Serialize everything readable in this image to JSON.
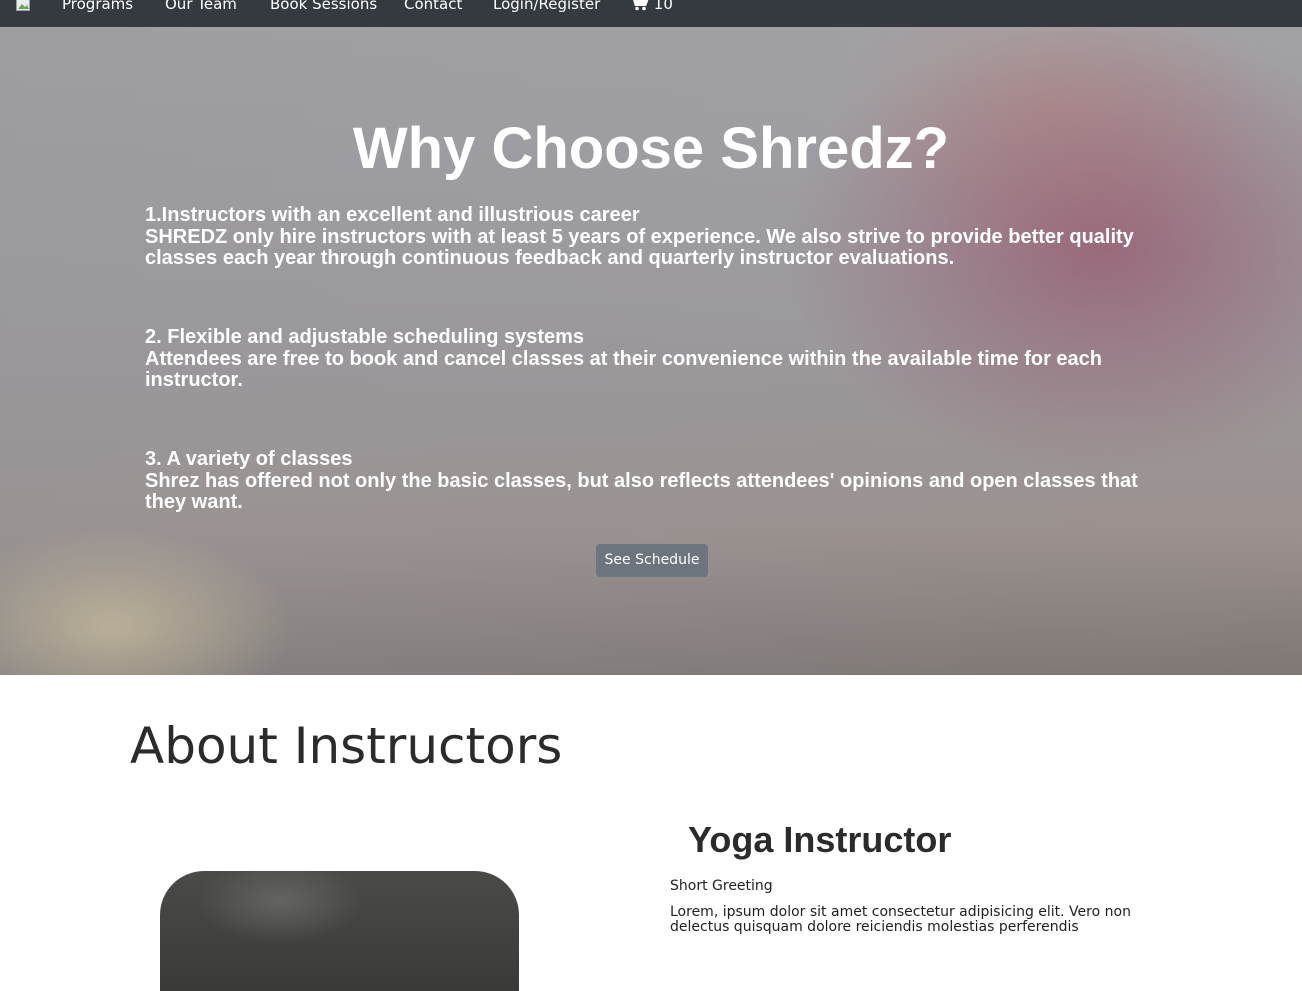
{
  "navbar": {
    "items": [
      {
        "label": "Programs"
      },
      {
        "label": "Our Team"
      },
      {
        "label": "Book Sessions"
      },
      {
        "label": "Contact"
      },
      {
        "label": "Login/Register"
      }
    ],
    "cart_count": "10"
  },
  "hero": {
    "title": "Why Choose Shredz?",
    "features": [
      {
        "heading": "1.Instructors with an excellent and illustrious career",
        "text": "SHREDZ only hire instructors with at least 5 years of experience. We also strive to provide better quality classes each year through continuous feedback and quarterly instructor evaluations."
      },
      {
        "heading": "2. Flexible and adjustable scheduling systems",
        "text": "Attendees are free to book and cancel classes at their convenience within the available time for each instructor."
      },
      {
        "heading": "3. A variety of classes",
        "text": "Shrez has offered not only the basic classes, but also reflects attendees' opinions and open classes that they want."
      }
    ],
    "button_label": "See Schedule"
  },
  "about": {
    "title": "About Instructors",
    "instructor": {
      "role": "Yoga Instructor",
      "greeting": "Short Greeting",
      "bio": "Lorem, ipsum dolor sit amet consectetur adipisicing elit. Vero non delectus quisquam dolore reiciendis molestias perferendis"
    }
  },
  "colors": {
    "navbar_bg": "#343a40",
    "button_bg": "#6c757d",
    "text_dark": "#2b2b2b"
  }
}
